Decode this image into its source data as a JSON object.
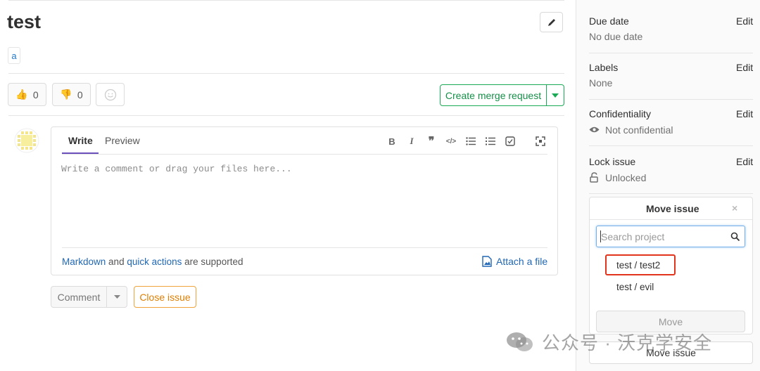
{
  "issue": {
    "title": "test",
    "label": "a",
    "thumbs_up_count": "0",
    "thumbs_down_count": "0"
  },
  "actions": {
    "create_merge_request": "Create merge request"
  },
  "editor": {
    "tab_write": "Write",
    "tab_preview": "Preview",
    "placeholder": "Write a comment or drag your files here...",
    "markdown_link": "Markdown",
    "and_text": "and",
    "quick_actions_link": "quick actions",
    "supported_text": "are supported",
    "attach_label": "Attach a file",
    "toolbar": {
      "bold": "B",
      "italic": "I",
      "quote": "❞",
      "code": "</>"
    }
  },
  "footer_buttons": {
    "comment": "Comment",
    "close_issue": "Close issue"
  },
  "sidebar": {
    "due_date": {
      "title": "Due date",
      "edit": "Edit",
      "value": "No due date"
    },
    "labels": {
      "title": "Labels",
      "edit": "Edit",
      "value": "None"
    },
    "confidentiality": {
      "title": "Confidentiality",
      "edit": "Edit",
      "value": "Not confidential"
    },
    "lock_issue": {
      "title": "Lock issue",
      "edit": "Edit",
      "value": "Unlocked"
    },
    "move_panel": {
      "title": "Move issue",
      "close": "×",
      "search_placeholder": "Search project",
      "projects": [
        "test / test2",
        "test / evil"
      ],
      "move_button": "Move"
    },
    "move_issue_button": "Move issue"
  },
  "watermark": {
    "text": "公众号 · 沃克学安全"
  },
  "colors": {
    "accent": "#6b4fbb",
    "green": "#1aaa55",
    "orange": "#f0a33a",
    "link": "#1f67b5",
    "highlight": "#e2341d"
  }
}
